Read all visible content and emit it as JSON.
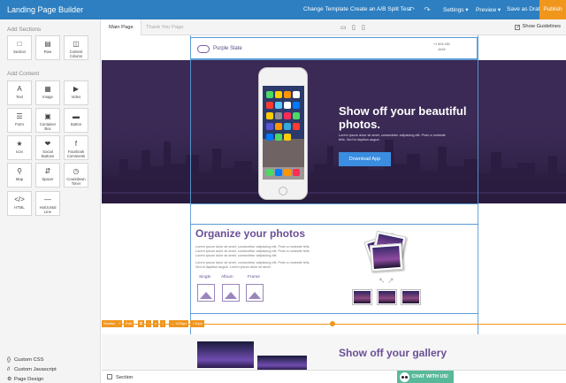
{
  "app": {
    "title": "Landing Page Builder"
  },
  "topbar": {
    "change_template": "Change Template",
    "ab_split": "Create an A/B Split Test",
    "settings": "Settings ▾",
    "preview": "Preview ▾",
    "save_draft": "Save as Draft",
    "publish": "Publish"
  },
  "sidebar": {
    "add_sections": "Add Sections",
    "section_tiles": [
      {
        "label": "Section",
        "icon": "square-icon"
      },
      {
        "label": "Row",
        "icon": "row-icon"
      },
      {
        "label": "Content Column",
        "icon": "column-icon"
      }
    ],
    "add_content": "Add Content",
    "content_tiles": [
      {
        "label": "Text",
        "icon": "text-icon"
      },
      {
        "label": "Image",
        "icon": "image-icon"
      },
      {
        "label": "Video",
        "icon": "video-icon"
      },
      {
        "label": "Form",
        "icon": "form-icon"
      },
      {
        "label": "Container Box",
        "icon": "container-icon"
      },
      {
        "label": "Button",
        "icon": "button-icon"
      },
      {
        "label": "Icon",
        "icon": "star-icon"
      },
      {
        "label": "Social Buttons",
        "icon": "social-icon"
      },
      {
        "label": "Facebook Comments",
        "icon": "facebook-icon"
      },
      {
        "label": "Map",
        "icon": "map-icon"
      },
      {
        "label": "Spacer",
        "icon": "spacer-icon"
      },
      {
        "label": "Countdown Timer",
        "icon": "timer-icon"
      },
      {
        "label": "HTML",
        "icon": "code-icon"
      },
      {
        "label": "Horizontal Line",
        "icon": "line-icon"
      }
    ],
    "links": [
      {
        "label": "Custom CSS",
        "icon": "css-icon"
      },
      {
        "label": "Custom Javascript",
        "icon": "js-icon"
      },
      {
        "label": "Page Design",
        "icon": "gear-icon"
      }
    ]
  },
  "tabs": {
    "main": "Main Page",
    "thanks": "Thank You Page"
  },
  "guidelines": {
    "label": "Show Guidelines",
    "checked": true
  },
  "page": {
    "logo_text": "Purple Slate",
    "phone": "+1 604 451",
    "phone2": "4444",
    "hero_title": "Show off your beautiful photos.",
    "hero_text": "Lorem ipsum dolor sit amet, consectetur adipiscing elit. Proin a molestie felis. Sed id dapibus augue.",
    "hero_button": "Download App",
    "section2_title": "Organize your photos",
    "section2_p1": "Lorem ipsum dolor sit amet, consectetur adipiscing elit. Proin a molestie felis. Lorem ipsum dolor sit amet, consectetur adipiscing elit. Proin a molestie felis. Lorem ipsum dolor sit amet, consectetur adipiscing elit.",
    "section2_p2": "Lorem ipsum dolor sit amet, consectetur adipiscing elit. Proin a molestie felis. Sed id dapibus augue. Lorem ipsum dolor sit amet.",
    "tab_single": "Single",
    "tab_album": "Album",
    "tab_frame": "Frame",
    "section3_title": "Show off your gallery"
  },
  "row_toolbar": {
    "section": "Section",
    "edit": "Edit",
    "width": "↔ 1200px",
    "height": "↕ 40px"
  },
  "bottombar": {
    "section": "Section",
    "chat": "CHAT WITH US!"
  },
  "colors": {
    "primary": "#2d7fc1",
    "publish": "#f0961d",
    "purple": "#6b4f96",
    "chat": "#58b99a"
  }
}
